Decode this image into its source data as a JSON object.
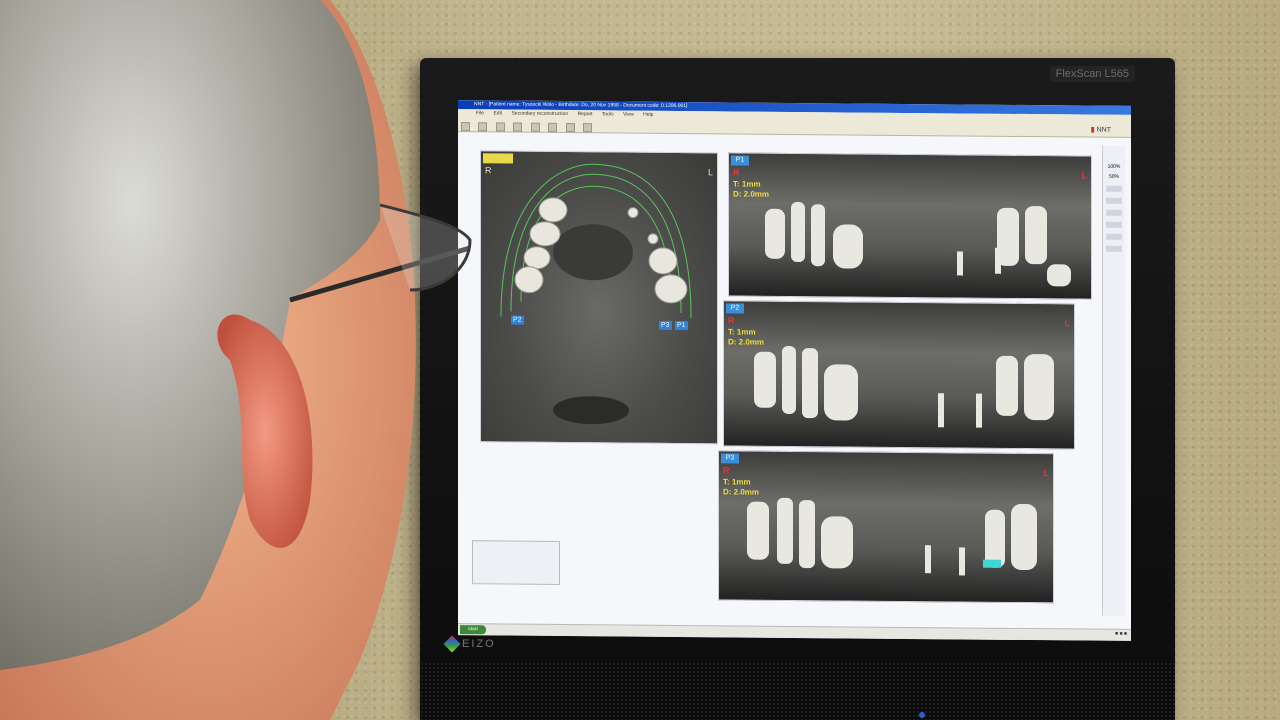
{
  "monitor": {
    "model_label": "FlexScan L565",
    "brand": "EIZO"
  },
  "app": {
    "title": "NNT - [Patient name: Tyszecki Wolo - Birthdate: Do, 20 Nov 1958 - Document code: 0.1206.001]",
    "menu": [
      "File",
      "Edit",
      "Secondary reconstruction",
      "Report",
      "Tools",
      "View",
      "Help"
    ],
    "logo_text": "NNT"
  },
  "views": {
    "axial": {
      "tag": "",
      "right_label": "R",
      "left_label": "L",
      "curve_labels": [
        "P2",
        "P3",
        "P1"
      ]
    },
    "p1": {
      "tag": "P1",
      "right_label": "R",
      "left_label": "L",
      "thickness": "T: 1mm",
      "distance": "D: 2.0mm"
    },
    "p2": {
      "tag": "P2",
      "right_label": "R",
      "left_label": "L",
      "thickness": "T: 1mm",
      "distance": "D: 2.0mm"
    },
    "p3": {
      "tag": "P3",
      "right_label": "R",
      "left_label": "L",
      "thickness": "T: 1mm",
      "distance": "D: 2.0mm"
    }
  },
  "zoom_options": [
    "100%",
    "50%"
  ],
  "taskbar": {
    "start_label": "start"
  }
}
